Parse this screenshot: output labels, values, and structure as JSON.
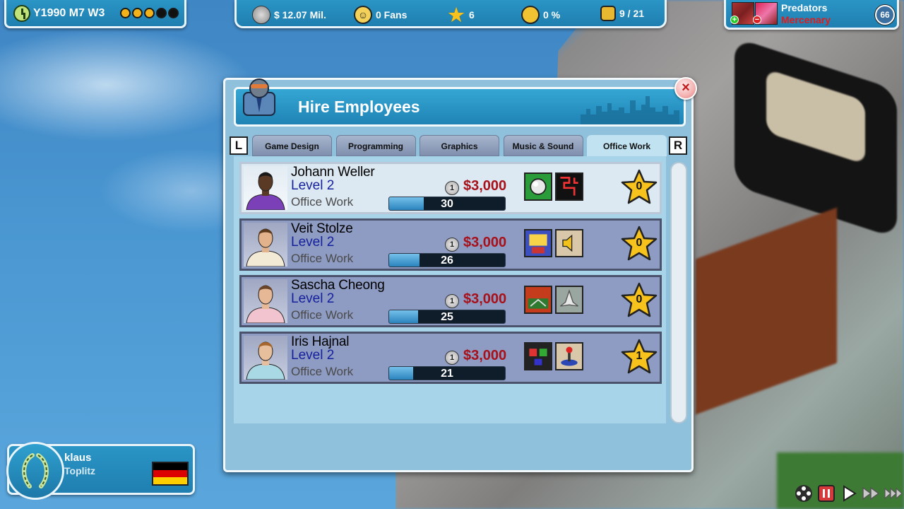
{
  "hud": {
    "date": "Y1990 M7 W3",
    "week_dots": [
      {
        "color": "#f2b21b"
      },
      {
        "color": "#f2b21b"
      },
      {
        "color": "#f2b21b"
      },
      {
        "color": "#111111"
      },
      {
        "color": "#111111"
      }
    ],
    "money": "$ 12.07 Mil.",
    "fans": "0 Fans",
    "stars": "6",
    "hype": "0 %",
    "unlocks": "9 / 21"
  },
  "competitor": {
    "name": "Predators",
    "type": "Mercenary",
    "level": "66"
  },
  "dialog": {
    "title": "Hire Employees",
    "close_label": "×",
    "left_label": "L",
    "right_label": "R",
    "tabs": [
      {
        "label": "Game Design",
        "active": false
      },
      {
        "label": "Programming",
        "active": false
      },
      {
        "label": "Graphics",
        "active": false
      },
      {
        "label": "Music & Sound",
        "active": false
      },
      {
        "label": "Office Work",
        "active": true
      }
    ],
    "employees": [
      {
        "name": "Johann Weller",
        "level": "Level 2",
        "dept": "Office Work",
        "coin": "1",
        "salary": "$3,000",
        "skill": 30,
        "skill_fraction": 0.3,
        "stars": "0",
        "skin": "#5a3a24",
        "shirt": "#7b3fb8",
        "hair": "#1a1a1a",
        "perk1": "pinball-perk",
        "perk2": "maze-perk"
      },
      {
        "name": "Veit Stolze",
        "level": "Level 2",
        "dept": "Office Work",
        "coin": "1",
        "salary": "$3,000",
        "skill": 26,
        "skill_fraction": 0.26,
        "stars": "0",
        "skin": "#e2b28c",
        "shirt": "#f3ead6",
        "hair": "#5b3a1e",
        "perk1": "arcade-perk",
        "perk2": "speaker-perk"
      },
      {
        "name": "Sascha Cheong",
        "level": "Level 2",
        "dept": "Office Work",
        "coin": "1",
        "salary": "$3,000",
        "skill": 25,
        "skill_fraction": 0.25,
        "stars": "0",
        "skin": "#e6b896",
        "shirt": "#f2c4cf",
        "hair": "#6a4426",
        "perk1": "racing-perk",
        "perk2": "spaceship-perk"
      },
      {
        "name": "Iris Hajnal",
        "level": "Level 2",
        "dept": "Office Work",
        "coin": "1",
        "salary": "$3,000",
        "skill": 21,
        "skill_fraction": 0.21,
        "stars": "1",
        "skin": "#e8bf9c",
        "shirt": "#a9d9e4",
        "hair": "#a5652b",
        "perk1": "retro-game-perk",
        "perk2": "joystick-perk"
      }
    ]
  },
  "player": {
    "name": "klaus",
    "city": "Toplitz"
  }
}
